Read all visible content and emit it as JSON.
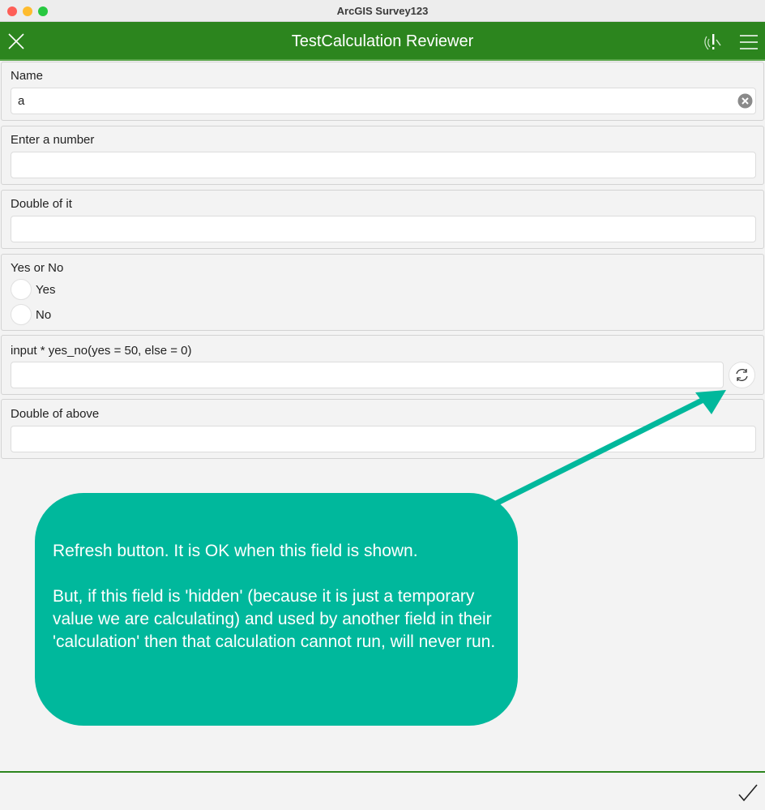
{
  "window": {
    "title": "ArcGIS Survey123"
  },
  "header": {
    "title": "TestCalculation Reviewer"
  },
  "fields": {
    "name": {
      "label": "Name",
      "value": "a"
    },
    "number": {
      "label": "Enter a number",
      "value": ""
    },
    "double": {
      "label": "Double of it",
      "value": ""
    },
    "yesno": {
      "label": "Yes or No",
      "options": [
        "Yes",
        "No"
      ]
    },
    "calc": {
      "label": "input * yes_no(yes = 50, else = 0)",
      "value": ""
    },
    "double_above": {
      "label": "Double of above",
      "value": ""
    }
  },
  "annotation": {
    "line1": "Refresh button. It is OK when this field is shown.",
    "line2": "But, if this field is 'hidden' (because it is just a temporary value we are calculating) and used by another field in their 'calculation' then that calculation cannot run, will never run.",
    "color": "#00b89c"
  },
  "colors": {
    "brand": "#2c851e"
  }
}
